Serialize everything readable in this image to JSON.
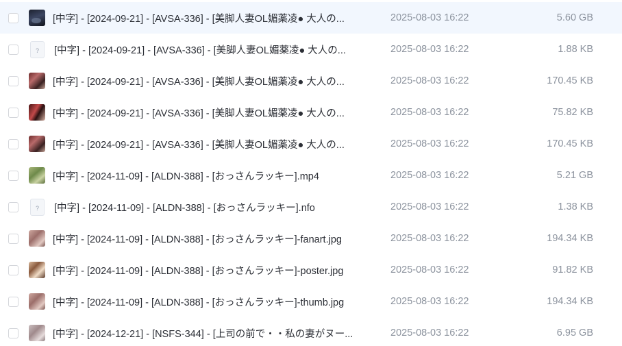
{
  "files": [
    {
      "name": "[中字] - [2024-09-21] - [AVSA-336] - [美脚人妻OL媚薬凌● 大人の...",
      "date": "2025-08-03 16:22",
      "size": "5.60 GB",
      "thumb": "video-thumbnail"
    },
    {
      "name": "[中字] - [2024-09-21] - [AVSA-336] - [美脚人妻OL媚薬凌● 大人の...",
      "date": "2025-08-03 16:22",
      "size": "1.88 KB",
      "thumb": "unknown-file-icon"
    },
    {
      "name": "[中字] - [2024-09-21] - [AVSA-336] - [美脚人妻OL媚薬凌● 大人の...",
      "date": "2025-08-03 16:22",
      "size": "170.45 KB",
      "thumb": "image-thumbnail"
    },
    {
      "name": "[中字] - [2024-09-21] - [AVSA-336] - [美脚人妻OL媚薬凌● 大人の...",
      "date": "2025-08-03 16:22",
      "size": "75.82 KB",
      "thumb": "image-thumbnail"
    },
    {
      "name": "[中字] - [2024-09-21] - [AVSA-336] - [美脚人妻OL媚薬凌● 大人の...",
      "date": "2025-08-03 16:22",
      "size": "170.45 KB",
      "thumb": "image-thumbnail"
    },
    {
      "name": "[中字] - [2024-11-09] - [ALDN-388] - [おっさんラッキー].mp4",
      "date": "2025-08-03 16:22",
      "size": "5.21 GB",
      "thumb": "video-thumbnail"
    },
    {
      "name": "[中字] - [2024-11-09] - [ALDN-388] - [おっさんラッキー].nfo",
      "date": "2025-08-03 16:22",
      "size": "1.38 KB",
      "thumb": "unknown-file-icon"
    },
    {
      "name": "[中字] - [2024-11-09] - [ALDN-388] - [おっさんラッキー]-fanart.jpg",
      "date": "2025-08-03 16:22",
      "size": "194.34 KB",
      "thumb": "image-thumbnail"
    },
    {
      "name": "[中字] - [2024-11-09] - [ALDN-388] - [おっさんラッキー]-poster.jpg",
      "date": "2025-08-03 16:22",
      "size": "91.82 KB",
      "thumb": "image-thumbnail"
    },
    {
      "name": "[中字] - [2024-11-09] - [ALDN-388] - [おっさんラッキー]-thumb.jpg",
      "date": "2025-08-03 16:22",
      "size": "194.34 KB",
      "thumb": "image-thumbnail"
    },
    {
      "name": "[中字] - [2024-12-21] - [NSFS-344] - [上司の前で・・私の妻がヌー...",
      "date": "2025-08-03 16:22",
      "size": "6.95 GB",
      "thumb": "video-thumbnail"
    }
  ],
  "unknown_icon_glyph": "?",
  "colors": {
    "selected_row": "#f2f7fe",
    "name_text": "#2c2f36",
    "meta_text": "#8b929d",
    "checkbox_border": "#d4d6db"
  }
}
